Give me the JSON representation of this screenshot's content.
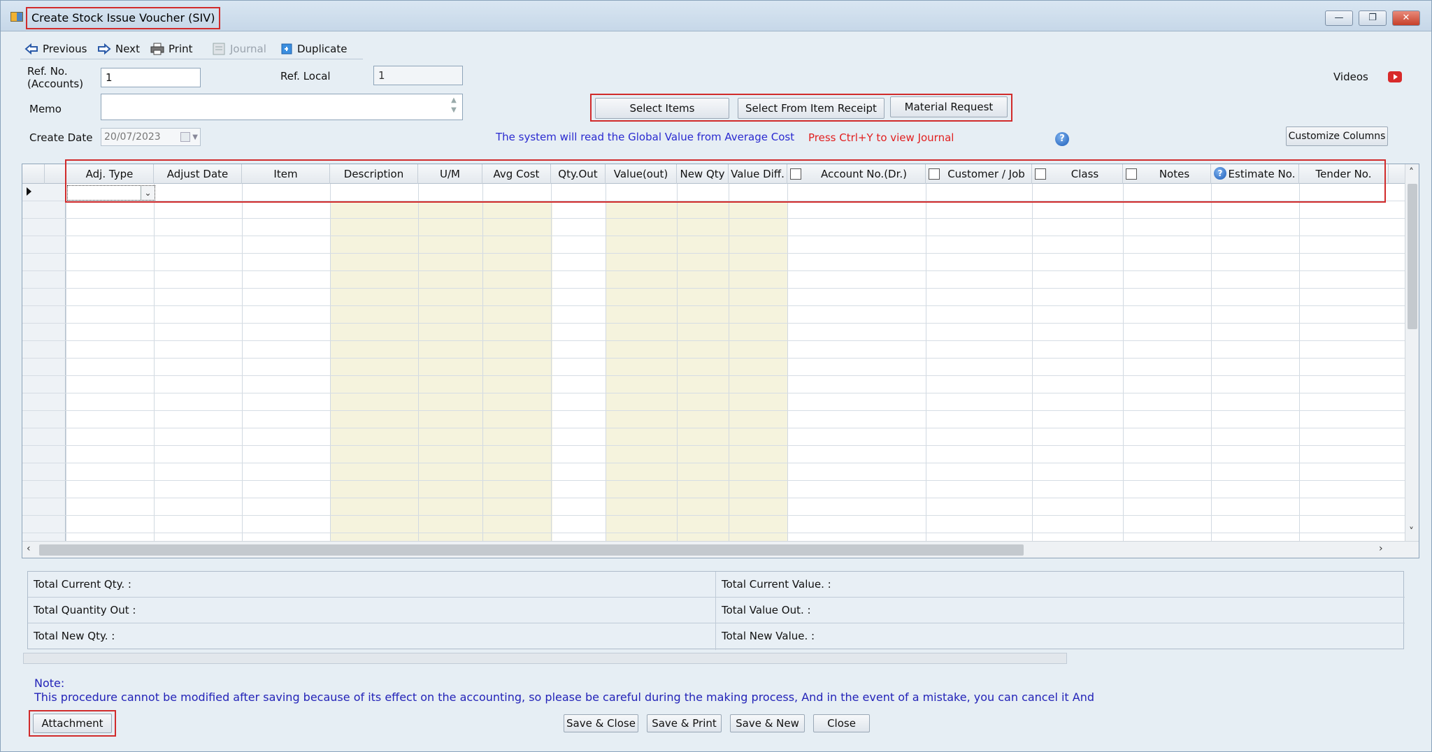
{
  "window": {
    "title": "Create Stock Issue Voucher (SIV)",
    "controls": {
      "minimize": "—",
      "maximize": "❐",
      "close": "✕"
    }
  },
  "toolbar": {
    "previous": "Previous",
    "next": "Next",
    "print": "Print",
    "journal": "Journal",
    "duplicate": "Duplicate"
  },
  "form": {
    "ref_no_label": "Ref. No.\n(Accounts)",
    "ref_no_value": "1",
    "ref_local_label": "Ref. Local",
    "ref_local_value": "1",
    "memo_label": "Memo",
    "memo_value": "",
    "create_date_label": "Create Date",
    "create_date_value": "20/07/2023"
  },
  "actions": {
    "select_items": "Select Items",
    "select_from_receipt": "Select From Item Receipt",
    "material_request": "Material Request",
    "customize_columns": "Customize Columns",
    "videos": "Videos"
  },
  "messages": {
    "global_value": "The system will read the Global Value from Average Cost",
    "ctrl_y": "Press Ctrl+Y to view Journal"
  },
  "grid": {
    "columns": [
      "Adj. Type",
      "Adjust Date",
      "Item",
      "Description",
      "U/M",
      "Avg Cost",
      "Qty.Out",
      "Value(out)",
      "New Qty",
      "Value Diff.",
      "Account No.(Dr.)",
      "Customer / Job",
      "Class",
      "Notes",
      "Estimate No.",
      "Tender No."
    ],
    "rows": []
  },
  "totals": {
    "current_qty": "Total Current Qty. :",
    "quantity_out": "Total Quantity Out :",
    "new_qty": "Total New Qty. :",
    "current_value": "Total Current Value. :",
    "value_out": "Total Value Out. :",
    "new_value": "Total New Value. :"
  },
  "note": {
    "title": "Note:",
    "text": "This procedure cannot be modified after saving because of its effect on the accounting, so please be careful during the making process, And in the event of a mistake, you can cancel it And"
  },
  "footer": {
    "attachment": "Attachment",
    "save_close": "Save & Close",
    "save_print": "Save & Print",
    "save_new": "Save & New",
    "close": "Close"
  },
  "colors": {
    "highlight_red": "#d12b2b",
    "info_blue": "#2a2ad0",
    "info_red": "#e12020",
    "readonly_column": "#f5f3dd"
  }
}
